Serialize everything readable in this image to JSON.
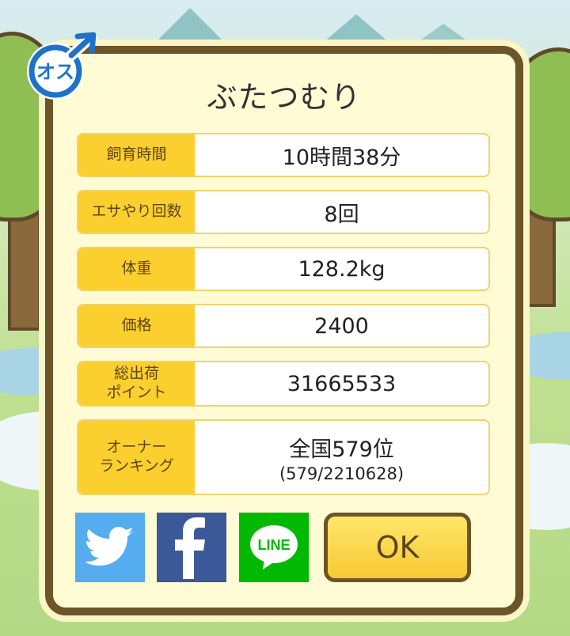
{
  "pet": {
    "name": "ぶたつむり",
    "gender_badge": "オス"
  },
  "stats": [
    {
      "label": "飼育時間",
      "value": "10時間38分"
    },
    {
      "label": "エサやり回数",
      "value": "8回"
    },
    {
      "label": "体重",
      "value": "128.2kg"
    },
    {
      "label": "価格",
      "value": "2400"
    },
    {
      "label": "総出荷\nポイント",
      "value": "31665533"
    },
    {
      "label": "オーナー\nランキング",
      "value": "全国579位",
      "sub": "(579/2210628)"
    }
  ],
  "share": {
    "line_label": "LINE"
  },
  "ok_label": "OK",
  "icons": {
    "gender": "male-symbol-icon",
    "twitter": "twitter-bird-icon",
    "facebook": "facebook-f-icon",
    "line": "line-chat-icon"
  },
  "colors": {
    "panel_bg": "#fffbd5",
    "panel_border": "#6c5526",
    "label_bg": "#fbcf2e",
    "twitter": "#55acee",
    "facebook": "#3b5998",
    "line": "#00b900",
    "gender_blue": "#1e73c8"
  }
}
